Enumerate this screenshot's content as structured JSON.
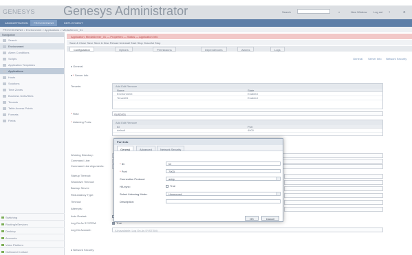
{
  "caption": {
    "prefix": "",
    "highlight": "",
    "middle": "",
    "highlight2": ""
  },
  "header": {
    "logo": "GENESYS",
    "title": "Genesys Administrator",
    "search_label": "Search",
    "search_placeholder": "",
    "new_window": "New Window",
    "logout": "Log out",
    "help": ""
  },
  "nav": {
    "tabs": [
      "ADMINISTRATION",
      "PROVISIONING",
      "DEPLOYMENT"
    ],
    "active": 1
  },
  "breadcrumb": "PROVISIONING > Environment > Applications > MediaServer_01",
  "sidebar": {
    "title": "Navigation",
    "sections": [
      "Search",
      "Environment"
    ],
    "items": [
      "Alarm Conditions",
      "Scripts",
      "Application Templates",
      "Applications",
      "Hosts",
      "Solutions",
      "Time Zones",
      "Business Units/Sites",
      "Tenants",
      "Table Access Points",
      "Formats",
      "Fields"
    ],
    "selected": 3,
    "bottom": [
      "Switching",
      "Routing/eServices",
      "Desktop",
      "Accounts",
      "Voice Platform",
      "Outbound Contact"
    ]
  },
  "main": {
    "error_bar": "Application: MediaServer_01 — Properties — Status — Application Info",
    "toolbar": "Save & Close   Save   Save & New   Reload   Uninstall   Start   Stop   Graceful Stop",
    "tabs": [
      "Configuration",
      "Options",
      "Permissions",
      "Dependencies",
      "Alarms",
      "Logs"
    ],
    "top_links": [
      "General",
      "Server Info",
      "Network Security"
    ],
    "section_general": "General",
    "section_server": "Server Info",
    "tenants_label": "Tenants:",
    "tenant_toolbar": "Add   Edit   Remove",
    "tenant_cols": [
      "Name",
      "State"
    ],
    "tenant_rows": [
      [
        "Environment",
        "Enabled"
      ],
      [
        "Tenant01",
        "Enabled"
      ]
    ],
    "host_label": "Host:",
    "host_value": "SUS0201",
    "ports_label": "Listening Ports:",
    "ports_toolbar": "Add   Edit   Remove",
    "ports_cols": [
      "ID",
      "Port"
    ],
    "ports_rows": [
      [
        "default",
        "4000"
      ]
    ],
    "left_labels": [
      "Working Directory:",
      "Command Line:",
      "Command Line Arguments:",
      "Startup Timeout:",
      "Shutdown Timeout:",
      "Backup Server:",
      "Redundancy Type:",
      "Timeout:",
      "Attempts:",
      "Auto Restart:",
      "Log On As SYSTEM:",
      "Log On Account:"
    ],
    "auto_restart": "True",
    "logon_system": "True",
    "logon_account_placeholder": "(Unavailable: Log On As SYSTEM)",
    "section_network": "Network Security"
  },
  "dialog": {
    "title": "Port Info",
    "tabs": [
      "General",
      "Advanced",
      "Network Security"
    ],
    "active_tab": 0,
    "fields": {
      "id_label": "ID:",
      "id_value": "fei",
      "port_label": "Port:",
      "port_value": "7003",
      "protocol_label": "Connection Protocol:",
      "protocol_value": "addp",
      "ha_label": "HA sync:",
      "ha_value": "True",
      "mode_label": "Select Listening Mode:",
      "mode_value": "Unsecured",
      "desc_label": "Description:",
      "desc_value": ""
    },
    "ok": "OK",
    "cancel": "Cancel"
  },
  "colors": {
    "nav": "#5e7fa8",
    "error": "#f2c8c8",
    "accent": "#2b55c7"
  }
}
